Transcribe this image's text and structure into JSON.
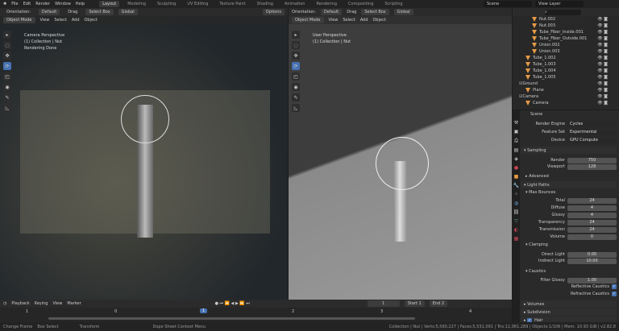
{
  "menu": {
    "items": [
      "File",
      "Edit",
      "Render",
      "Window",
      "Help"
    ],
    "workspaces": [
      "Layout",
      "Modeling",
      "Sculpting",
      "UV Editing",
      "Texture Paint",
      "Shading",
      "Animation",
      "Rendering",
      "Compositing",
      "Scripting"
    ],
    "active": "Layout",
    "scene": "Scene",
    "view_layer": "View Layer"
  },
  "toolheader": {
    "orientation": "Orientation:",
    "pivot": "Default",
    "drag": "Drag",
    "select": "Select Box",
    "transform": "Global",
    "options": "Options"
  },
  "viewport_header": {
    "mode": "Object Mode",
    "menus": [
      "View",
      "Select",
      "Add",
      "Object"
    ]
  },
  "left_viewport": {
    "lines": [
      "Camera Perspective",
      "(1) Collection | Nut",
      "Rendering Done"
    ]
  },
  "right_viewport": {
    "lines": [
      "User Perspective",
      "(1) Collection | Nut"
    ]
  },
  "outliner": {
    "items": [
      {
        "name": "Nut.002",
        "indent": 2
      },
      {
        "name": "Nut.003",
        "indent": 2
      },
      {
        "name": "Tube_Fiber_Inside.001",
        "indent": 2
      },
      {
        "name": "Tube_Fiber_Outside.001",
        "indent": 2
      },
      {
        "name": "Union.002",
        "indent": 2
      },
      {
        "name": "Union.003",
        "indent": 2
      },
      {
        "name": "Tube_1.002",
        "indent": 1
      },
      {
        "name": "Tube_1.003",
        "indent": 1
      },
      {
        "name": "Tube_1.004",
        "indent": 1
      },
      {
        "name": "Tube_1.005",
        "indent": 1
      },
      {
        "name": "Ground",
        "indent": 0,
        "collection": true
      },
      {
        "name": "Plane",
        "indent": 1
      },
      {
        "name": "Camera",
        "indent": 0,
        "collection": true
      },
      {
        "name": "Camera",
        "indent": 1
      }
    ]
  },
  "properties": {
    "scene": "Scene",
    "render_engine": {
      "label": "Render Engine",
      "value": "Cycles"
    },
    "feature_set": {
      "label": "Feature Set",
      "value": "Experimental"
    },
    "device": {
      "label": "Device",
      "value": "GPU Compute"
    },
    "sampling": "Sampling",
    "render": {
      "label": "Render",
      "value": "750"
    },
    "viewport": {
      "label": "Viewport",
      "value": "128"
    },
    "advanced": "Advanced",
    "light_paths": "Light Paths",
    "max_bounces": "Max Bounces",
    "bounces": [
      {
        "label": "Total",
        "value": "24"
      },
      {
        "label": "Diffuse",
        "value": "4"
      },
      {
        "label": "Glossy",
        "value": "4"
      },
      {
        "label": "Transparency",
        "value": "24"
      },
      {
        "label": "Transmission",
        "value": "24"
      },
      {
        "label": "Volume",
        "value": "0"
      }
    ],
    "clamping": "Clamping",
    "direct_light": {
      "label": "Direct Light",
      "value": "0.00"
    },
    "indirect_light": {
      "label": "Indirect Light",
      "value": "10.00"
    },
    "caustics": "Caustics",
    "filter_glossy": {
      "label": "Filter Glossy",
      "value": "1.00"
    },
    "reflective": "Reflective Caustics",
    "refractive": "Refractive Caustics",
    "volumes": "Volumes",
    "subdivision": "Subdivision",
    "hair": "Hair"
  },
  "timeline": {
    "menus": [
      "Playback",
      "Keying",
      "View",
      "Marker"
    ],
    "current": "1",
    "start_label": "Start",
    "start": "1",
    "end_label": "End",
    "end": "2",
    "ticks": [
      "1",
      "0",
      "1",
      "2",
      "3",
      "4"
    ]
  },
  "statusbar": {
    "hints": [
      "Change Frame",
      "Box Select",
      "Transform",
      "Dope Sheet Context Menu"
    ],
    "stats": "Collection | Nut | Verts:5,560,227 | Faces:5,531,091 | Tris:11,061,289 | Objects:1/106 | Mem: 10.93 GiB | v2.82.8"
  },
  "colors": {
    "accent": "#4772b3",
    "object": "#e69a46",
    "mesh": "#5fb38a"
  }
}
